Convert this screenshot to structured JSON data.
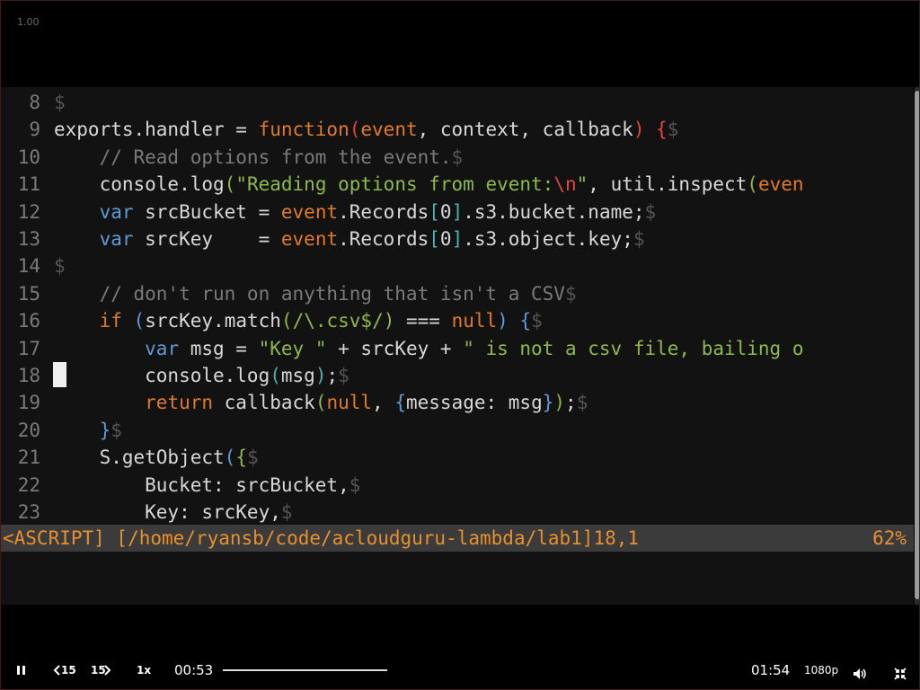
{
  "player": {
    "speed_badge": "1.00",
    "controls": {
      "rewind_label": "15",
      "forward_label": "15",
      "speed_label": "1x",
      "current_time": "00:53",
      "total_time": "01:54",
      "quality_label": "1080p",
      "progress_fraction": 1.0
    },
    "icons": {
      "pause": "pause-icon",
      "rewind": "rewind-15-icon",
      "forward": "forward-15-icon",
      "volume": "volume-icon",
      "exit_fullscreen": "exit-fullscreen-icon"
    }
  },
  "editor": {
    "eol_marker": "$",
    "cursor_line": 18,
    "lines": [
      {
        "num": "8",
        "tokens": []
      },
      {
        "num": "9",
        "tokens": [
          {
            "t": "exports.handler = ",
            "c": "text"
          },
          {
            "t": "function",
            "c": "kw"
          },
          {
            "t": "(",
            "c": "red"
          },
          {
            "t": "event",
            "c": "kw"
          },
          {
            "t": ", context, callback",
            "c": "text"
          },
          {
            "t": ")",
            "c": "red"
          },
          {
            "t": " ",
            "c": "text"
          },
          {
            "t": "{",
            "c": "red"
          }
        ]
      },
      {
        "num": "10",
        "tokens": [
          {
            "t": "    // Read options from the event.",
            "c": "comment"
          }
        ]
      },
      {
        "num": "11",
        "tokens": [
          {
            "t": "    console.log",
            "c": "text"
          },
          {
            "t": "(",
            "c": "green"
          },
          {
            "t": "\"Reading options from event:",
            "c": "string"
          },
          {
            "t": "\\n",
            "c": "red"
          },
          {
            "t": "\"",
            "c": "string"
          },
          {
            "t": ", util.inspect",
            "c": "text"
          },
          {
            "t": "(",
            "c": "green"
          },
          {
            "t": "even",
            "c": "kw"
          }
        ],
        "no_eol": true
      },
      {
        "num": "12",
        "tokens": [
          {
            "t": "    ",
            "c": "text"
          },
          {
            "t": "var",
            "c": "blue"
          },
          {
            "t": " srcBucket = ",
            "c": "text"
          },
          {
            "t": "event",
            "c": "kw"
          },
          {
            "t": ".Records",
            "c": "text"
          },
          {
            "t": "[",
            "c": "cyan"
          },
          {
            "t": "0",
            "c": "text"
          },
          {
            "t": "]",
            "c": "cyan"
          },
          {
            "t": ".s3.bucket.name;",
            "c": "text"
          }
        ]
      },
      {
        "num": "13",
        "tokens": [
          {
            "t": "    ",
            "c": "text"
          },
          {
            "t": "var",
            "c": "blue"
          },
          {
            "t": " srcKey    = ",
            "c": "text"
          },
          {
            "t": "event",
            "c": "kw"
          },
          {
            "t": ".Records",
            "c": "text"
          },
          {
            "t": "[",
            "c": "cyan"
          },
          {
            "t": "0",
            "c": "text"
          },
          {
            "t": "]",
            "c": "cyan"
          },
          {
            "t": ".s3.object.key;",
            "c": "text"
          }
        ]
      },
      {
        "num": "14",
        "tokens": []
      },
      {
        "num": "15",
        "tokens": [
          {
            "t": "    // don't run on anything that isn't a CSV",
            "c": "comment"
          }
        ]
      },
      {
        "num": "16",
        "tokens": [
          {
            "t": "    ",
            "c": "text"
          },
          {
            "t": "if",
            "c": "kw"
          },
          {
            "t": " ",
            "c": "text"
          },
          {
            "t": "(",
            "c": "blue"
          },
          {
            "t": "srcKey.match",
            "c": "text"
          },
          {
            "t": "(",
            "c": "green"
          },
          {
            "t": "/\\.csv$/",
            "c": "string"
          },
          {
            "t": ")",
            "c": "green"
          },
          {
            "t": " === ",
            "c": "text"
          },
          {
            "t": "null",
            "c": "kw"
          },
          {
            "t": ")",
            "c": "blue"
          },
          {
            "t": " ",
            "c": "text"
          },
          {
            "t": "{",
            "c": "blue"
          }
        ]
      },
      {
        "num": "17",
        "tokens": [
          {
            "t": "        ",
            "c": "text"
          },
          {
            "t": "var",
            "c": "blue"
          },
          {
            "t": " msg = ",
            "c": "text"
          },
          {
            "t": "\"Key \"",
            "c": "string"
          },
          {
            "t": " + srcKey + ",
            "c": "text"
          },
          {
            "t": "\" is not a csv file, bailing o",
            "c": "string"
          }
        ],
        "no_eol": true
      },
      {
        "num": "18",
        "tokens": [
          {
            "t": "        console.log",
            "c": "text"
          },
          {
            "t": "(",
            "c": "cyan"
          },
          {
            "t": "msg",
            "c": "text"
          },
          {
            "t": ")",
            "c": "cyan"
          },
          {
            "t": ";",
            "c": "text"
          }
        ]
      },
      {
        "num": "19",
        "tokens": [
          {
            "t": "        ",
            "c": "text"
          },
          {
            "t": "return",
            "c": "kw"
          },
          {
            "t": " callback",
            "c": "text"
          },
          {
            "t": "(",
            "c": "green"
          },
          {
            "t": "null",
            "c": "kw"
          },
          {
            "t": ", ",
            "c": "text"
          },
          {
            "t": "{",
            "c": "blue"
          },
          {
            "t": "message: msg",
            "c": "text"
          },
          {
            "t": "}",
            "c": "blue"
          },
          {
            "t": ")",
            "c": "green"
          },
          {
            "t": ";",
            "c": "text"
          }
        ]
      },
      {
        "num": "20",
        "tokens": [
          {
            "t": "    ",
            "c": "text"
          },
          {
            "t": "}",
            "c": "blue"
          }
        ]
      },
      {
        "num": "21",
        "tokens": [
          {
            "t": "    S.getObject",
            "c": "text"
          },
          {
            "t": "(",
            "c": "blue"
          },
          {
            "t": "{",
            "c": "green"
          }
        ]
      },
      {
        "num": "22",
        "tokens": [
          {
            "t": "        Bucket: srcBucket,",
            "c": "text"
          }
        ]
      },
      {
        "num": "23",
        "tokens": [
          {
            "t": "        Key: srcKey,",
            "c": "text"
          }
        ]
      }
    ]
  },
  "statusline": {
    "left": "<ASCRIPT] [/home/ryansb/code/acloudguru-lambda/lab1]18,1",
    "right": "62%"
  },
  "colors": {
    "keyword": "#e07b24",
    "var_keyword": "#5d9ad6",
    "comment": "#7a7a7a",
    "string": "#8db94b",
    "escape": "#e0483a",
    "status_text": "#e8902e",
    "status_bg": "#3b3b3b"
  }
}
